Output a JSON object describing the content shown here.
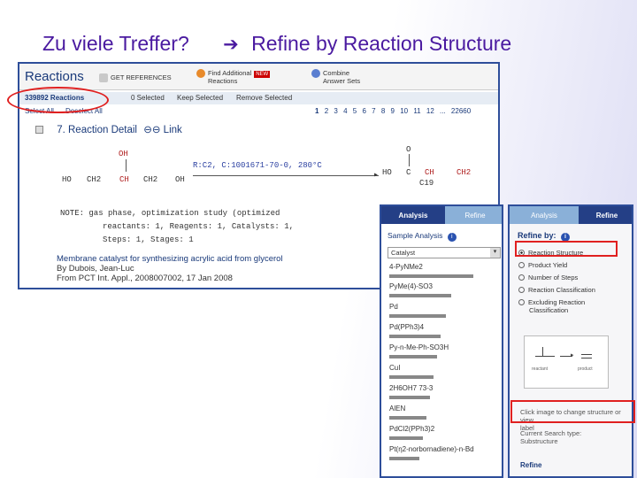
{
  "slide": {
    "title_left": "Zu viele Treffer?",
    "arrow": "➔",
    "title_right": "Refine by Reaction Structure"
  },
  "reactions": {
    "title": "Reactions",
    "get_references": "GET REFERENCES",
    "find_additional": "Find Additional",
    "find_additional_2": "Reactions",
    "new_badge": "NEW",
    "combine": "Combine",
    "combine_2": "Answer Sets",
    "count": "339892 Reactions",
    "selected": "0 Selected",
    "keep_selected": "Keep Selected",
    "remove_selected": "Remove Selected",
    "select_all": "Select All",
    "deselect_all": "Deselect All",
    "pages": [
      "1",
      "2",
      "3",
      "4",
      "5",
      "6",
      "7",
      "8",
      "9",
      "10",
      "11",
      "12",
      "...",
      "22660"
    ],
    "detail_index": "7.",
    "detail_label": "Reaction Detail",
    "link_label": "Link",
    "structure": {
      "oh_top": "OH",
      "reactant_left": "HO",
      "ch2a": "CH2",
      "ch": "CH",
      "ch2b": "CH2",
      "oh_right": "OH",
      "conditions": "R:C2, C:1001671-70-0, 280°C",
      "o_top": "O",
      "ho": "HO",
      "c": "C",
      "ch_red": "CH",
      "ch2_red": "CH2",
      "product_id": "C19"
    },
    "notes": [
      "NOTE: gas phase, optimization study (optimized",
      "reactants: 1, Reagents: 1, Catalysts: 1,",
      "Steps: 1, Stages: 1"
    ],
    "pub_title": "Membrane catalyst for synthesizing acrylic acid from glycerol",
    "pub_author": "By Dubois, Jean-Luc",
    "pub_source": "From PCT Int. Appl., 2008007002, 17 Jan 2008"
  },
  "analysis": {
    "tab_analysis": "Analysis",
    "tab_refine": "Refine",
    "section": "Sample Analysis",
    "dropdown_value": "Catalyst",
    "items": [
      "4-PyNMe2",
      "PyMe(4)-SO3",
      "Pd",
      "Pd(PPh3)4",
      "Py-n-Me-Ph-SO3H",
      "CuI",
      "2H6OH7 73-3",
      "AlEN",
      "PdCl2(PPh3)2",
      "Pt(η2-norbornadiene)-n-Bd"
    ]
  },
  "refine": {
    "tab_analysis": "Analysis",
    "tab_refine": "Refine",
    "refine_by": "Refine by:",
    "options": [
      "Reaction Structure",
      "Product Yield",
      "Number of Steps",
      "Reaction Classification",
      "Excluding Reaction",
      "Classification"
    ],
    "thumb_left": "reactant",
    "thumb_right": "product",
    "click_text": "Click image to change structure or view",
    "click_text_2": "label",
    "current_search": "Current Search type:",
    "current_search_2": "Substructure",
    "refine_button": "Refine"
  },
  "colors": {
    "title": "#4a1aa0",
    "link": "#1a3a7a",
    "highlight": "#e02020",
    "panel_border": "#2e4e9a"
  }
}
